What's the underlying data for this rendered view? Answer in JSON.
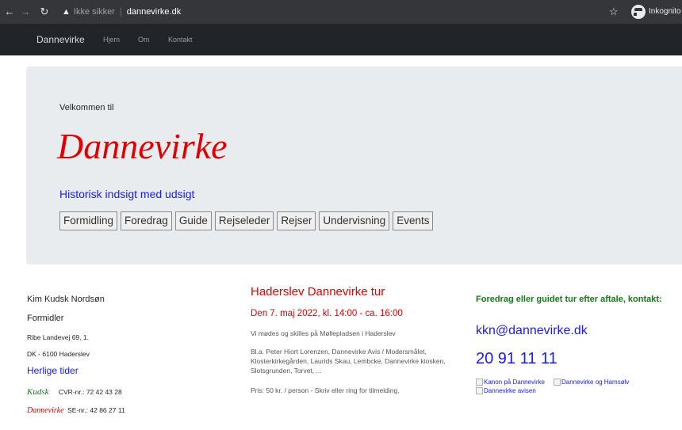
{
  "browser": {
    "security_label": "Ikke sikker",
    "url": "dannevirke.dk",
    "profile_label": "Inkognito"
  },
  "navbar": {
    "brand": "Dannevirke",
    "links": [
      "Hjem",
      "Om",
      "Kontakt"
    ]
  },
  "hero": {
    "welcome": "Velkommen til",
    "title": "Dannevirke",
    "tagline": "Historisk indsigt med udsigt",
    "buttons": [
      "Formidling",
      "Foredrag",
      "Guide",
      "Rejseleder",
      "Rejser",
      "Undervisning",
      "Events"
    ]
  },
  "contact_left": {
    "name": "Kim Kudsk Nordsøn",
    "role": "Formidler",
    "street": "Ribe Landevej 69, 1.",
    "city": "DK - 6100 Haderslev",
    "link": "Herlige tider",
    "kudsk_logo_text": "Kudsk",
    "kudsk_cvr": "CVR-nr.: 72 42 43 28",
    "dv_logo_text": "Dannevirke",
    "dv_se": "SE-nr.: 42 86 27 11"
  },
  "event": {
    "title": "Haderslev Dannevirke tur",
    "date": "Den 7. maj 2022, kl. 14:00 - ca. 16:00",
    "meet": "Vi mødes og skilles på Møllepladsen i Haderslev",
    "details": "Bl.a. Peter Hiort Lorenzen, Dannevirke Avis / Modersmålet, Klosterkirkegården, Laurids Skau, Lembcke, Dannevirke kiosken, Slotsgrunden, Torvet, ...",
    "price": "Pris: 50 kr. / person - Skriv eller ring for tilmelding."
  },
  "contact_right": {
    "heading": "Foredrag eller guidet tur efter aftale, kontakt:",
    "email": "kkn@dannevirke.dk",
    "phone": "20 91 11 11",
    "images": [
      "Kanon på Dannevirke",
      "Dannevirke og Hamsølv",
      "Dannevirke avisen"
    ]
  },
  "colors": {
    "accent_red": "#e00000",
    "link_blue": "#1a1aff",
    "green": "#157a15",
    "navbar_bg": "#212529",
    "jumbotron_bg": "#e9ecef"
  }
}
